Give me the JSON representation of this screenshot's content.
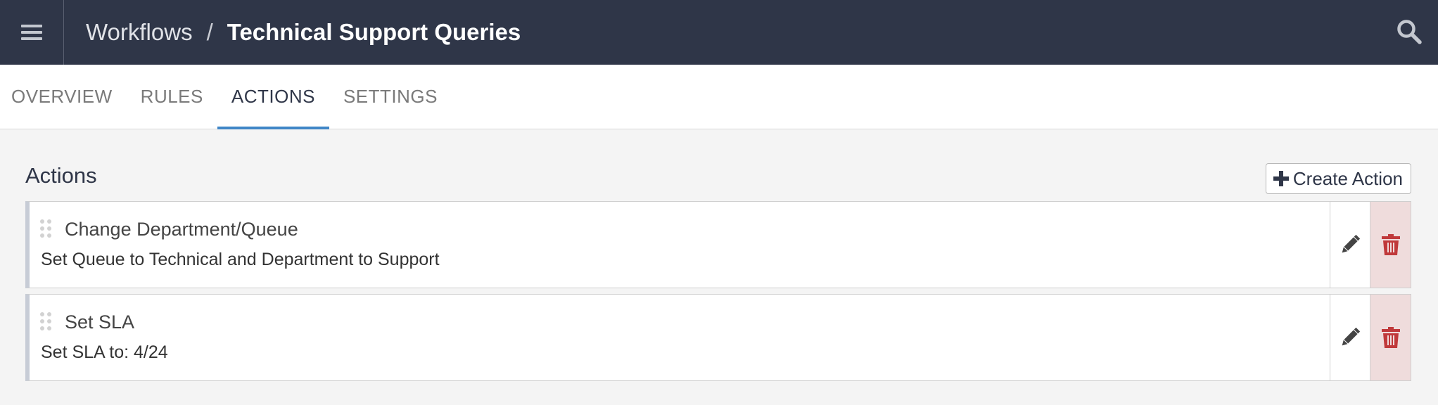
{
  "header": {
    "menu_icon": "hamburger-menu-icon",
    "breadcrumb": {
      "parent": "Workflows",
      "separator": "/",
      "current": "Technical Support Queries"
    },
    "search_icon": "search-icon"
  },
  "tabs": [
    {
      "label": "OVERVIEW",
      "active": false
    },
    {
      "label": "RULES",
      "active": false
    },
    {
      "label": "ACTIONS",
      "active": true
    },
    {
      "label": "SETTINGS",
      "active": false
    }
  ],
  "actions_section": {
    "title": "Actions",
    "create_button_label": "Create Action",
    "items": [
      {
        "title": "Change Department/Queue",
        "description": "Set Queue to Technical and Department to Support"
      },
      {
        "title": "Set SLA",
        "description": "Set SLA to: 4/24"
      }
    ]
  },
  "colors": {
    "topbar": "#2f3648",
    "active_tab_underline": "#3f86c7",
    "delete_bg": "#efdcdc",
    "delete_icon": "#c0393b"
  }
}
